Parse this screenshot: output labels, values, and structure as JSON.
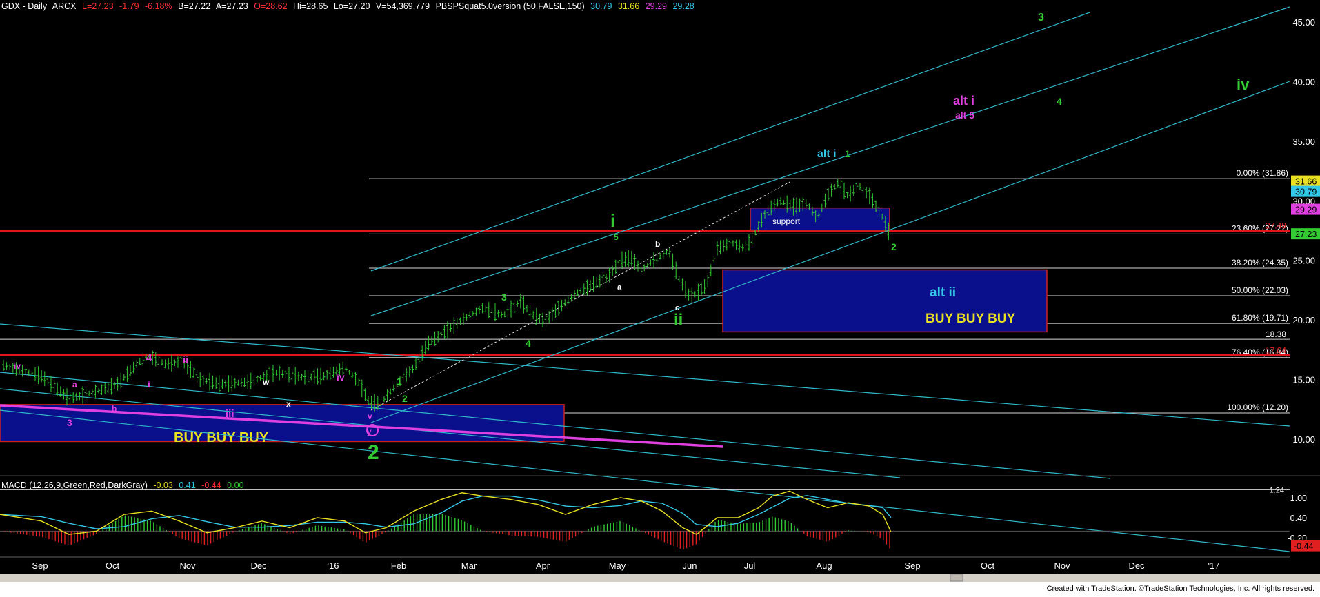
{
  "header": {
    "symbol": "GDX - Daily",
    "exchange": "ARCX",
    "last": "L=27.23",
    "change": "-1.79",
    "change_pct": "-6.18%",
    "bid": "B=27.22",
    "ask": "A=27.23",
    "open": "O=28.62",
    "high": "Hi=28.65",
    "low": "Lo=27.20",
    "volume": "V=54,369,779",
    "indicator": "PBSPSquat5.0version (50,FALSE,150)",
    "ind_values": [
      "30.79",
      "31.66",
      "29.29",
      "29.28"
    ]
  },
  "macd_header": {
    "label": "MACD (12,26,9,Green,Red,DarkGray)",
    "values": [
      "-0.03",
      "0.41",
      "-0.44",
      "0.00"
    ]
  },
  "footer": "Created with TradeStation. ©TradeStation Technologies, Inc. All rights reserved.",
  "colors": {
    "background": "#000000",
    "bar_green": "#33cc33",
    "channel": "#2fb8c8",
    "red_line": "#e0141a",
    "magenta": "#e040e0",
    "wave_green": "#33cc33",
    "cyan_label": "#33c8e8",
    "fib_line": "#d8d8d8",
    "box_fill": "#0a0f8c",
    "box_border": "#cc2020",
    "buy_text": "#e8e020",
    "macd_line": "#e8e020",
    "signal_line": "#33c8e8"
  },
  "chart_data": {
    "type": "candlestick",
    "price_axis": {
      "range": [
        7,
        47
      ],
      "ticks": [
        "45.00",
        "40.00",
        "35.00",
        "30.00",
        "25.00",
        "20.00",
        "15.00",
        "10.00"
      ],
      "badges": [
        {
          "value": "31.66",
          "price": 31.66,
          "color": "#e8e020",
          "text": "#000000"
        },
        {
          "value": "30.79",
          "price": 30.79,
          "color": "#33c8e8",
          "text": "#000000"
        },
        {
          "value": "29.29",
          "price": 29.29,
          "color": "#e040e0",
          "text": "#000000"
        },
        {
          "value": "27.23",
          "price": 27.23,
          "color": "#33cc33",
          "text": "#000000"
        }
      ]
    },
    "time_axis": [
      "Sep",
      "Oct",
      "Nov",
      "Dec",
      "'16",
      "Feb",
      "Mar",
      "Apr",
      "May",
      "Jun",
      "Jul",
      "Aug",
      "Sep",
      "Oct",
      "Nov",
      "Dec",
      "'17"
    ],
    "fib_levels": [
      {
        "label": "0.00% (31.86)",
        "price": 31.86
      },
      {
        "label": "23.60% (27.22)",
        "price": 27.22
      },
      {
        "label": "38.20% (24.35)",
        "price": 24.35
      },
      {
        "label": "50.00% (22.03)",
        "price": 22.03
      },
      {
        "label": "61.80% (19.71)",
        "price": 19.71
      },
      {
        "label": "76.40% (16.84)",
        "price": 16.84
      },
      {
        "label": "100.00% (12.20)",
        "price": 12.2
      }
    ],
    "level_labels": [
      {
        "text": "27.49",
        "price": 27.49
      },
      {
        "text": "18.38",
        "price": 18.38
      },
      {
        "text": "17.04",
        "price": 17.04
      }
    ],
    "boxes": [
      {
        "label": "support",
        "range": [
          27.5,
          29.4
        ]
      },
      {
        "label": "alt ii",
        "sublabel": "BUY  BUY   BUY",
        "range": [
          19.0,
          24.2
        ]
      },
      {
        "label": "BUY BUY BUY",
        "range": [
          9.8,
          12.9
        ]
      }
    ],
    "wave_labels": [
      {
        "text": "3",
        "color": "green",
        "price": 46.2
      },
      {
        "text": "iv",
        "color": "green",
        "price": 41.0
      },
      {
        "text": "alt i",
        "color": "magenta",
        "price": 37.6
      },
      {
        "text": "alt 5",
        "color": "magenta",
        "price": 36.1
      },
      {
        "text": "4",
        "color": "green",
        "price": 37.4
      },
      {
        "text": "alt i",
        "color": "cyan",
        "price": 34.2
      },
      {
        "text": "1",
        "color": "green",
        "price": 34.2
      },
      {
        "text": "i",
        "color": "green",
        "price": 29.5
      },
      {
        "text": "5",
        "color": "green",
        "price": 27.0
      },
      {
        "text": "b",
        "color": "white",
        "price": 26.2
      },
      {
        "text": "a",
        "color": "white",
        "price": 22.6
      },
      {
        "text": "c",
        "color": "white",
        "price": 21.0
      },
      {
        "text": "ii",
        "color": "green",
        "price": 19.9
      },
      {
        "text": "2",
        "color": "green",
        "price": 26.0
      },
      {
        "text": "3",
        "color": "green",
        "price": 21.6
      },
      {
        "text": "4",
        "color": "green",
        "price": 18.8
      },
      {
        "text": "1",
        "color": "green",
        "price": 15.4
      },
      {
        "text": "2",
        "color": "green",
        "price": 13.3
      },
      {
        "text": "2",
        "color": "green",
        "price": 8.9
      },
      {
        "text": "4",
        "color": "magenta",
        "price": 17.1
      },
      {
        "text": "ii",
        "color": "magenta",
        "price": 16.8
      },
      {
        "text": "i",
        "color": "magenta",
        "price": 15.6
      },
      {
        "text": "iii",
        "color": "magenta",
        "price": 12.4
      },
      {
        "text": "iv",
        "color": "magenta",
        "price": 15.9
      },
      {
        "text": "iv",
        "color": "magenta",
        "price": 16.4
      },
      {
        "text": "v",
        "color": "magenta",
        "price": 12.3
      },
      {
        "text": "3",
        "color": "magenta",
        "price": 11.6
      },
      {
        "text": "a",
        "color": "magenta",
        "price": 15.1
      },
      {
        "text": "b",
        "color": "magenta",
        "price": 12.7
      },
      {
        "text": "w",
        "color": "white",
        "price": 15.5
      },
      {
        "text": "x",
        "color": "white",
        "price": 13.1
      },
      {
        "text": "y",
        "color": "magenta",
        "price": 12.0
      }
    ],
    "macd_axis": {
      "ticks": [
        "1.00",
        "0.40",
        "-0.20"
      ],
      "top_label": "1.24",
      "badge": "-0.44"
    }
  }
}
